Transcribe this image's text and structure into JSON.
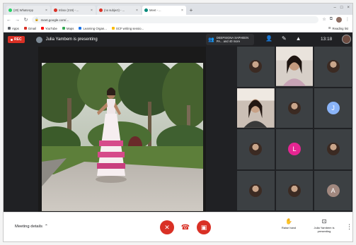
{
  "browser": {
    "tabs": [
      {
        "title": "(20) WhatsApp",
        "color": "#25d366"
      },
      {
        "title": "Inbox (219) - ...",
        "color": "#d93025"
      },
      {
        "title": "(no subject) - ...",
        "color": "#d93025"
      },
      {
        "title": "Meet - ...",
        "color": "#00897b"
      }
    ],
    "url": "meet.google.com/...",
    "bookmarks": [
      {
        "label": "Apps",
        "color": "#5f6368"
      },
      {
        "label": "Gmail",
        "color": "#d93025"
      },
      {
        "label": "YouTube",
        "color": "#ff0000"
      },
      {
        "label": "Maps",
        "color": "#34a853"
      },
      {
        "label": "Learning Organ...",
        "color": "#1a73e8"
      },
      {
        "label": "SCF writing sessio...",
        "color": "#fbbc04"
      }
    ],
    "reading_list": "Reading list"
  },
  "meet": {
    "rec_label": "REC",
    "presenter_text": "Julia Yambem is presenting",
    "notice_text": "DEEPSIGNA SAPHEEN PA... and 40 more",
    "clock": "13:18",
    "participants": [
      {
        "kind": "photo"
      },
      {
        "kind": "video"
      },
      {
        "kind": "photo"
      },
      {
        "kind": "video"
      },
      {
        "kind": "photo"
      },
      {
        "kind": "letter",
        "letter": "J",
        "color": "#8ab4f8"
      },
      {
        "kind": "photo"
      },
      {
        "kind": "letter",
        "letter": "L",
        "color": "#e52592"
      },
      {
        "kind": "photo"
      },
      {
        "kind": "photo"
      },
      {
        "kind": "photo"
      },
      {
        "kind": "letter",
        "letter": "A",
        "color": "#a1887f"
      }
    ]
  },
  "controls": {
    "meeting_details": "Meeting details",
    "raise_hand": "Raise hand",
    "presenting": "Julia Yambem is presenting"
  },
  "colors": {
    "accent_red": "#d93025",
    "meet_background": "#202124"
  }
}
